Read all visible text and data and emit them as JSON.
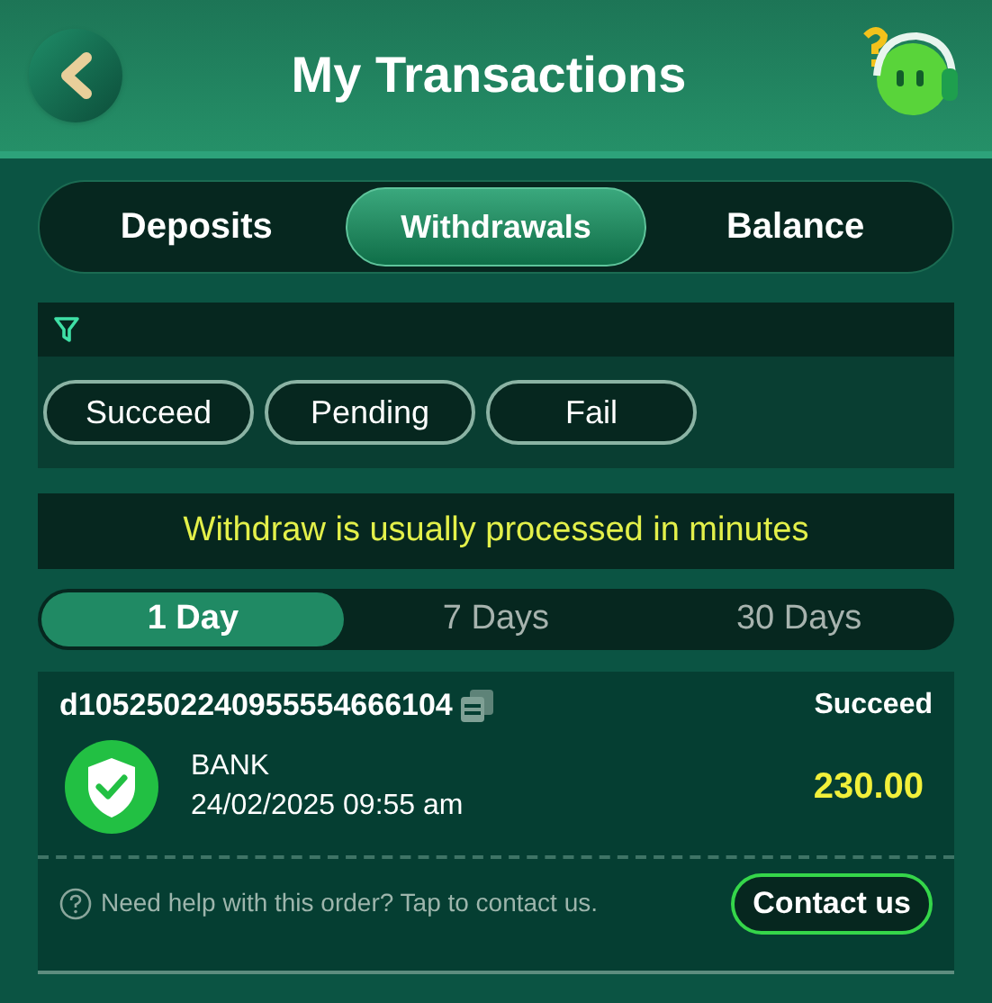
{
  "header": {
    "title": "My Transactions"
  },
  "tabs": [
    {
      "label": "Deposits",
      "selected": false
    },
    {
      "label": "Withdrawals",
      "selected": true
    },
    {
      "label": "Balance",
      "selected": false
    }
  ],
  "status_filters": [
    {
      "label": "Succeed",
      "selected": false
    },
    {
      "label": "Pending",
      "selected": false
    },
    {
      "label": "Fail",
      "selected": false
    }
  ],
  "notice": "Withdraw is usually processed in minutes",
  "periods": [
    {
      "label": "1 Day",
      "selected": true
    },
    {
      "label": "7 Days",
      "selected": false
    },
    {
      "label": "30 Days",
      "selected": false
    }
  ],
  "transactions": [
    {
      "order_id": "d1052502240955554666104",
      "status": "Succeed",
      "method": "BANK",
      "datetime": "24/02/2025 09:55 am",
      "amount": "230.00",
      "help_text": "Need help with this order? Tap to contact us.",
      "contact_button": "Contact us"
    }
  ]
}
